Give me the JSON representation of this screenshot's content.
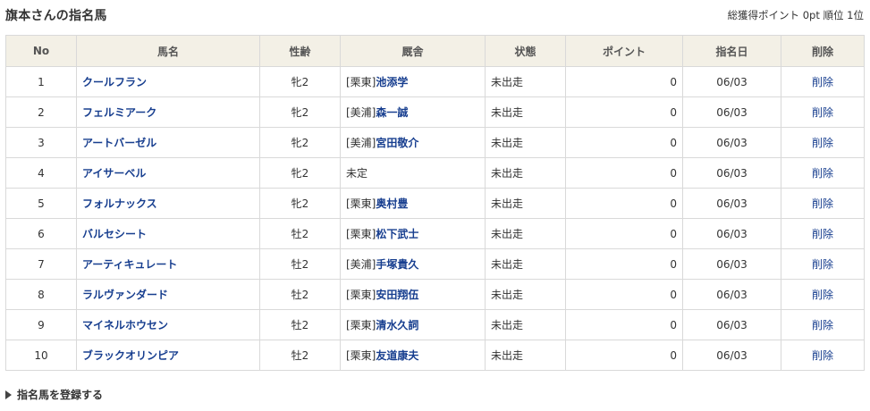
{
  "header": {
    "title": "旗本さんの指名馬",
    "total_points_label": "総獲得ポイント",
    "total_points_value": "0pt",
    "rank_label": "順位",
    "rank_value": "1位"
  },
  "table": {
    "columns": [
      "No",
      "馬名",
      "性齢",
      "厩舎",
      "状態",
      "ポイント",
      "指名日",
      "削除"
    ],
    "rows": [
      {
        "no": "1",
        "name": "クールフラン",
        "sex_age": "牝2",
        "stable_prefix": "[栗東]",
        "trainer": "池添学",
        "status": "未出走",
        "points": "0",
        "date": "06/03",
        "delete": "削除"
      },
      {
        "no": "2",
        "name": "フェルミアーク",
        "sex_age": "牝2",
        "stable_prefix": "[美浦]",
        "trainer": "森一誠",
        "status": "未出走",
        "points": "0",
        "date": "06/03",
        "delete": "削除"
      },
      {
        "no": "3",
        "name": "アートバーゼル",
        "sex_age": "牝2",
        "stable_prefix": "[美浦]",
        "trainer": "宮田敬介",
        "status": "未出走",
        "points": "0",
        "date": "06/03",
        "delete": "削除"
      },
      {
        "no": "4",
        "name": "アイサーベル",
        "sex_age": "牝2",
        "stable_prefix": "",
        "trainer": "未定",
        "status": "未出走",
        "points": "0",
        "date": "06/03",
        "delete": "削除"
      },
      {
        "no": "5",
        "name": "フォルナックス",
        "sex_age": "牝2",
        "stable_prefix": "[栗東]",
        "trainer": "奥村豊",
        "status": "未出走",
        "points": "0",
        "date": "06/03",
        "delete": "削除"
      },
      {
        "no": "6",
        "name": "バルセシート",
        "sex_age": "牡2",
        "stable_prefix": "[栗東]",
        "trainer": "松下武士",
        "status": "未出走",
        "points": "0",
        "date": "06/03",
        "delete": "削除"
      },
      {
        "no": "7",
        "name": "アーティキュレート",
        "sex_age": "牡2",
        "stable_prefix": "[美浦]",
        "trainer": "手塚貴久",
        "status": "未出走",
        "points": "0",
        "date": "06/03",
        "delete": "削除"
      },
      {
        "no": "8",
        "name": "ラルヴァンダード",
        "sex_age": "牡2",
        "stable_prefix": "[栗東]",
        "trainer": "安田翔伍",
        "status": "未出走",
        "points": "0",
        "date": "06/03",
        "delete": "削除"
      },
      {
        "no": "9",
        "name": "マイネルホウセン",
        "sex_age": "牡2",
        "stable_prefix": "[栗東]",
        "trainer": "清水久詞",
        "status": "未出走",
        "points": "0",
        "date": "06/03",
        "delete": "削除"
      },
      {
        "no": "10",
        "name": "ブラックオリンピア",
        "sex_age": "牡2",
        "stable_prefix": "[栗東]",
        "trainer": "友道康夫",
        "status": "未出走",
        "points": "0",
        "date": "06/03",
        "delete": "削除"
      }
    ]
  },
  "footer": {
    "register_label": "指名馬を登録する",
    "register_icon": "triangle-right-icon"
  },
  "colors": {
    "header_bg": "#f3f0e6",
    "border": "#d9d9d9",
    "link": "#173e8f",
    "text": "#333333"
  }
}
